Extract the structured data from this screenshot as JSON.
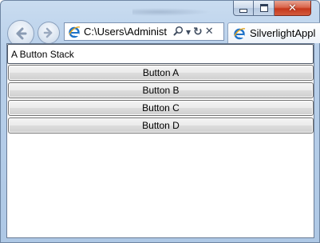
{
  "browser": {
    "address_text": "C:\\Users\\Administ",
    "tab_label": "SilverlightAppl",
    "icons": {
      "back": "back-arrow-icon",
      "forward": "forward-arrow-icon",
      "page": "ie-logo-icon",
      "search": "search-icon",
      "dropdown": "chevron-down-icon",
      "refresh": "refresh-icon",
      "stop": "stop-icon",
      "minimize": "minimize-icon",
      "maximize": "maximize-icon",
      "close": "close-icon"
    },
    "close_glyph": "✕",
    "dropdown_glyph": "▾",
    "refresh_glyph": "↻",
    "stop_glyph": "✕"
  },
  "app": {
    "stack_header": "A Button Stack",
    "buttons": [
      "Button A",
      "Button B",
      "Button C",
      "Button D"
    ]
  },
  "colors": {
    "close_button": "#c5381c",
    "frame": "#b9d0ea",
    "ie_logo": "#1f73c9"
  }
}
